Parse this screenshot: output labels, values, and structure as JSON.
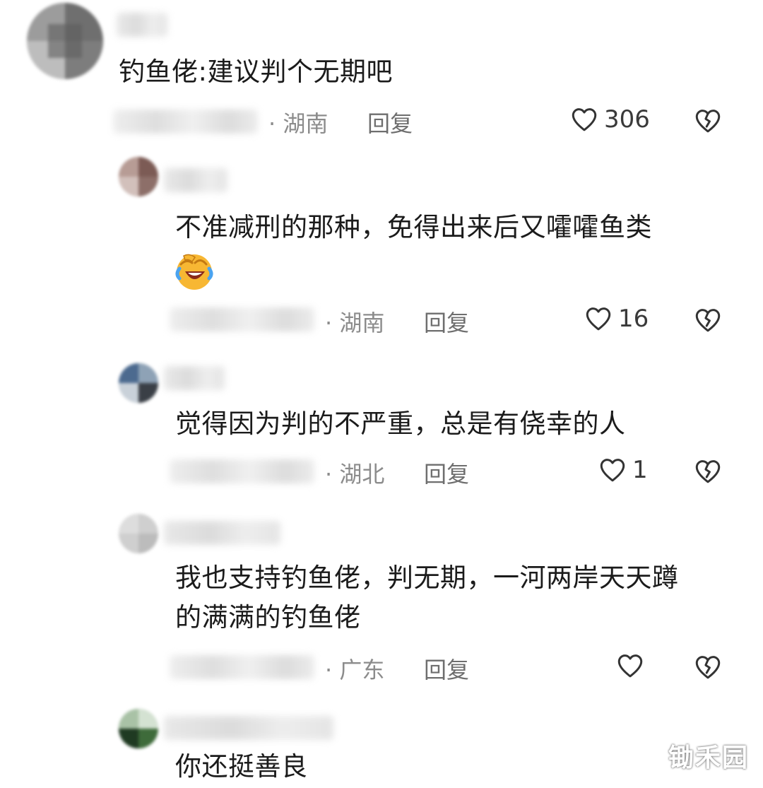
{
  "comments": [
    {
      "content": "钓鱼佬:建议判个无期吧",
      "location": "· 湖南",
      "reply_label": "回复",
      "like_count": "306"
    },
    {
      "content": "不准减刑的那种，免得出来后又嚯嚯鱼类",
      "emoji": "laughing-crying-emoji",
      "location": "· 湖南",
      "reply_label": "回复",
      "like_count": "16"
    },
    {
      "content": "觉得因为判的不严重，总是有侥幸的人",
      "location": "· 湖北",
      "reply_label": "回复",
      "like_count": "1"
    },
    {
      "content_line1": "我也支持钓鱼佬，判无期，一河两岸天天蹲",
      "content_line2": "的满满的钓鱼佬",
      "location": "· 广东",
      "reply_label": "回复",
      "like_count": ""
    },
    {
      "content": "你还挺善良"
    }
  ],
  "watermark": "锄禾园",
  "colors": {
    "text": "#1b1b1b",
    "meta": "#8c8c8c",
    "icon": "#333333",
    "emoji_face": "#f7b733"
  }
}
